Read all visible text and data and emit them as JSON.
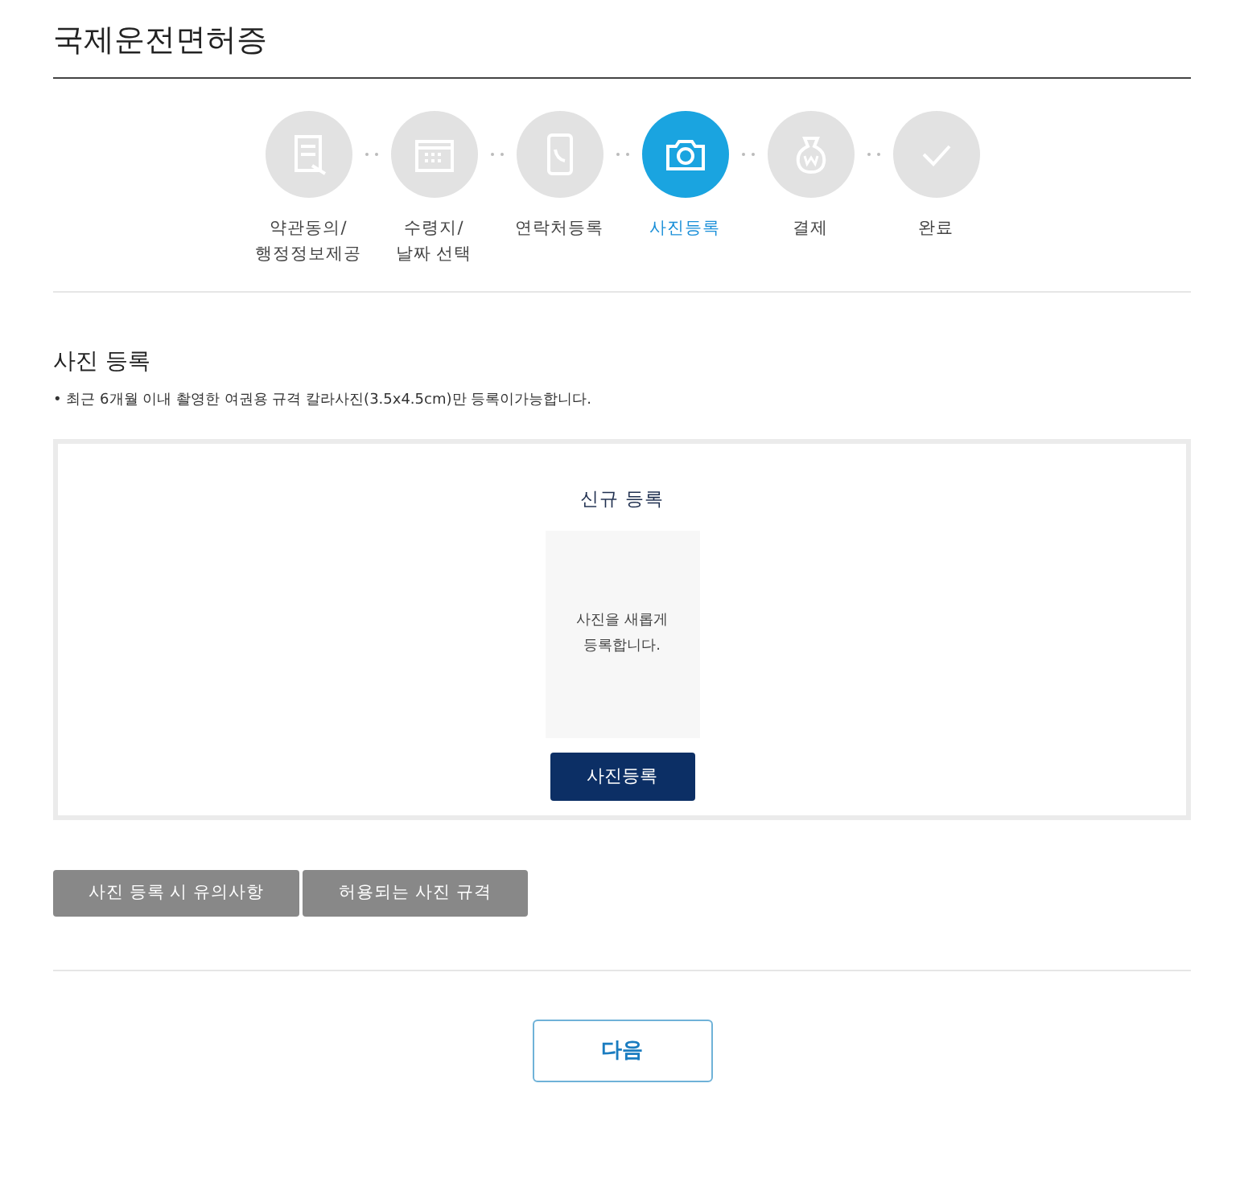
{
  "page_title": "국제운전면허증",
  "steps": [
    {
      "kind": "document",
      "label": "약관동의/\n행정정보제공",
      "selected": false
    },
    {
      "kind": "calendar",
      "label": "수령지/\n날짜 선택",
      "selected": false
    },
    {
      "kind": "phone",
      "label": "연락처등록",
      "selected": false
    },
    {
      "kind": "camera",
      "label": "사진등록",
      "selected": true
    },
    {
      "kind": "money-bag",
      "label": "결제",
      "selected": false
    },
    {
      "kind": "check",
      "label": "완료",
      "selected": false
    }
  ],
  "section": {
    "title": "사진 등록",
    "note": "• 최근 6개월 이내 촬영한 여권용 규격 칼라사진(3.5x4.5cm)만 등록이가능합니다."
  },
  "upload": {
    "title": "신규 등록",
    "placeholder_text": "사진을 새롭게\n등록합니다.",
    "button": "사진등록"
  },
  "info_buttons": [
    "사진 등록 시 유의사항",
    "허용되는 사진 규격"
  ],
  "next_button": "다음"
}
